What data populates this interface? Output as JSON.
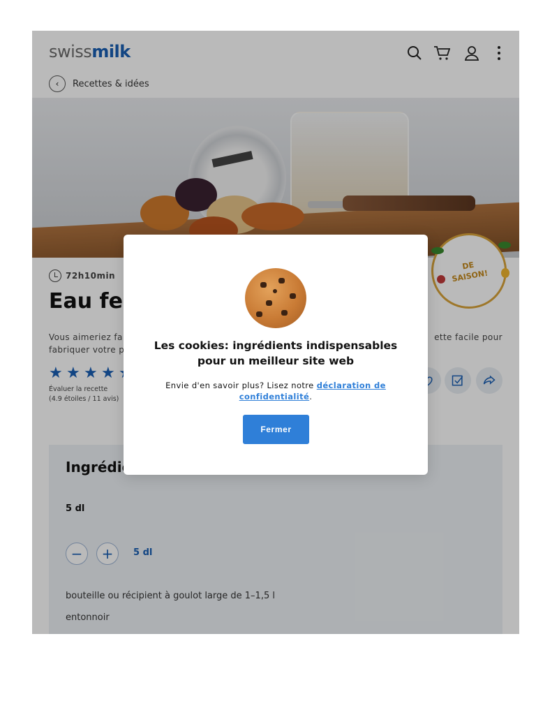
{
  "header": {
    "logo_part1": "swiss",
    "logo_part2": "milk",
    "back_label": "Recettes & idées",
    "icons": [
      "search-icon",
      "cart-icon",
      "user-icon",
      "more-icon"
    ]
  },
  "hero": {
    "badge_line1": "DE",
    "badge_line2": "SAISON!"
  },
  "recipe": {
    "time": "72h10min",
    "title": "Eau ferm",
    "intro_left": "Vous aimeriez fa",
    "intro_left2": "fabriquer votre p",
    "intro_right": "ette facile pour",
    "rating_label": "Évaluer la recette",
    "rating_detail": "(4.9 étoiles / 11 avis)",
    "stars": [
      "★",
      "★",
      "★",
      "★",
      "★"
    ]
  },
  "ingredients": {
    "heading": "Ingrédie",
    "portion": "5 dl",
    "portion_selected": "5 dl",
    "minus": "−",
    "plus": "+",
    "items": [
      "bouteille ou récipient à goulot large de 1–1,5 l",
      "entonnoir"
    ]
  },
  "cookie_modal": {
    "title": "Les cookies: ingrédients indispensables pour un meilleur site web",
    "text_prefix": "Envie d'en savoir plus? Lisez notre ",
    "link_text": "déclaration de confidentialité",
    "text_suffix": ".",
    "close_label": "Fermer"
  },
  "colors": {
    "brand_blue": "#1a5fb4",
    "button_blue": "#2f7fd8"
  }
}
